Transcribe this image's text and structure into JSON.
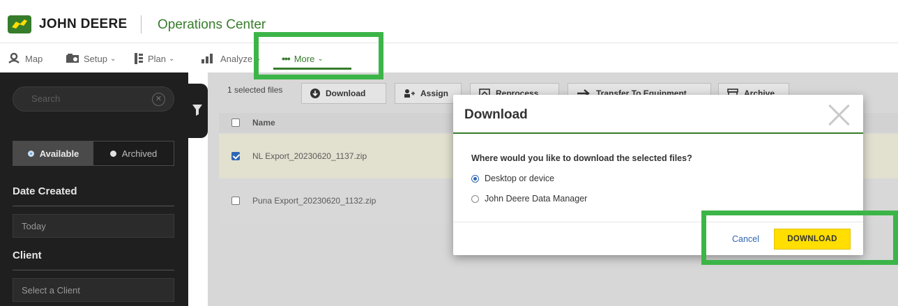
{
  "header": {
    "brand": "JOHN DEERE",
    "app_title": "Operations Center"
  },
  "nav": {
    "items": [
      {
        "label": "Map",
        "icon": "map-pin-icon"
      },
      {
        "label": "Setup",
        "icon": "setup-icon"
      },
      {
        "label": "Plan",
        "icon": "plan-icon"
      },
      {
        "label": "Analyze",
        "icon": "bar-chart-icon"
      },
      {
        "label": "More",
        "icon": "more-dots-icon"
      }
    ]
  },
  "sidebar": {
    "search_placeholder": "Search",
    "toggle": {
      "available": "Available",
      "archived": "Archived"
    },
    "date_created": {
      "heading": "Date Created",
      "value": "Today"
    },
    "client": {
      "heading": "Client",
      "placeholder": "Select a Client"
    }
  },
  "toolbar": {
    "selected_count": "1 selected files",
    "buttons": [
      "Download",
      "Assign",
      "Reprocess",
      "Transfer To Equipment",
      "Archive"
    ]
  },
  "table": {
    "header_name": "Name",
    "rows": [
      {
        "name": "NL Export_20230620_1137.zip",
        "checked": true
      },
      {
        "name": "Puna Export_20230620_1132.zip",
        "checked": false
      }
    ]
  },
  "modal": {
    "title": "Download",
    "question": "Where would you like to download the selected files?",
    "options": [
      {
        "label": "Desktop or device",
        "selected": true
      },
      {
        "label": "John Deere Data Manager",
        "selected": false
      }
    ],
    "cancel_label": "Cancel",
    "download_label": "DOWNLOAD"
  },
  "colors": {
    "brand_green": "#367c2b",
    "highlight_green": "#3cb548",
    "accent_yellow": "#ffde00",
    "link_blue": "#2f66b3"
  }
}
